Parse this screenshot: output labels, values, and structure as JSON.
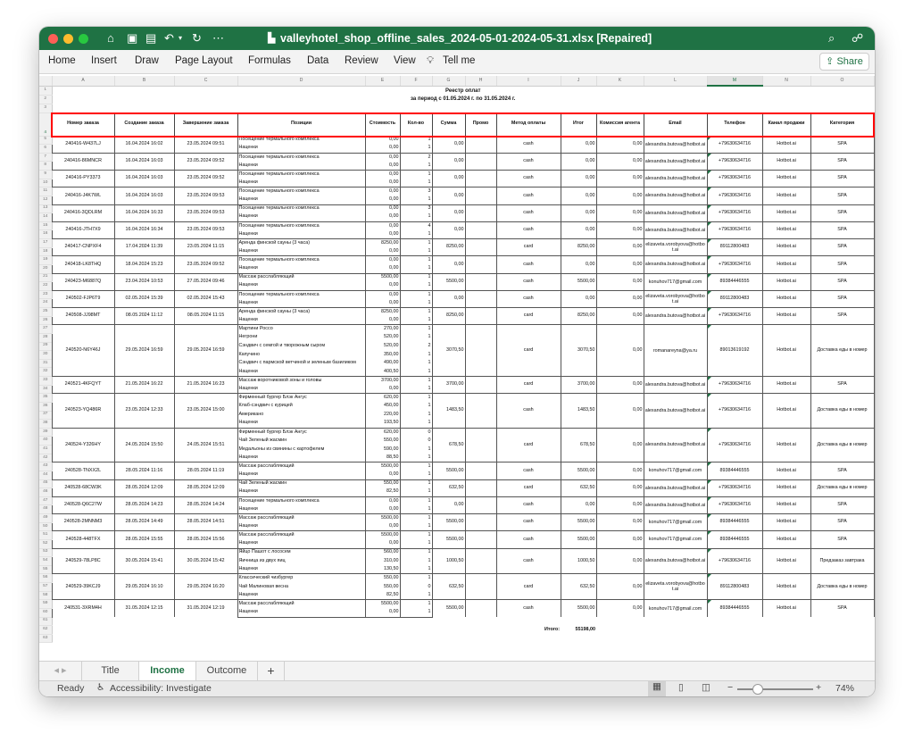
{
  "window": {
    "title": "valleyhotel_shop_offline_sales_2024-05-01-2024-05-31.xlsx [Repaired]"
  },
  "ribbon": {
    "tabs": [
      "Home",
      "Insert",
      "Draw",
      "Page Layout",
      "Formulas",
      "Data",
      "Review",
      "View"
    ],
    "tell_me": "Tell me",
    "share": "Share"
  },
  "columns": [
    "A",
    "B",
    "C",
    "D",
    "E",
    "F",
    "G",
    "H",
    "I",
    "J",
    "K",
    "L",
    "M",
    "N",
    "O"
  ],
  "report": {
    "title": "Реестр оплат",
    "period": "за период с 01.05.2024 г. по 31.05.2024 г."
  },
  "headers": [
    "Номер заказа",
    "Создание заказа",
    "Завершение заказа",
    "Позиции",
    "Стоимость",
    "Кол-во",
    "Сумма",
    "Промо",
    "Метод оплаты",
    "Итог",
    "Комиссия агента",
    "Email",
    "Телефон",
    "Канал продажи",
    "Категория"
  ],
  "orders": [
    {
      "id": "240416-W437LJ",
      "created": "16.04.2024 16:02",
      "completed": "23.05.2024 09:51",
      "items": [
        [
          "Посещение термального комплекса",
          "0,00",
          "1"
        ],
        [
          "Наценки",
          "0,00",
          "1"
        ]
      ],
      "sum": "0,00",
      "promo": "",
      "method": "cash",
      "total": "0,00",
      "commission": "0,00",
      "email": "alexandra.butova@hotbot.ai",
      "phone": "+79630634716",
      "channel": "Hotbot.ai",
      "category": "SPA"
    },
    {
      "id": "240416-86MNCR",
      "created": "16.04.2024 16:03",
      "completed": "23.05.2024 09:52",
      "items": [
        [
          "Посещение термального комплекса",
          "0,00",
          "2"
        ],
        [
          "Наценки",
          "0,00",
          "1"
        ]
      ],
      "sum": "0,00",
      "promo": "",
      "method": "cash",
      "total": "0,00",
      "commission": "0,00",
      "email": "alexandra.butova@hotbot.ai",
      "phone": "+79630634716",
      "channel": "Hotbot.ai",
      "category": "SPA"
    },
    {
      "id": "240416-PY3373",
      "created": "16.04.2024 16:03",
      "completed": "23.05.2024 09:52",
      "items": [
        [
          "Посещение термального комплекса",
          "0,00",
          "1"
        ],
        [
          "Наценки",
          "0,00",
          "1"
        ]
      ],
      "sum": "0,00",
      "promo": "",
      "method": "cash",
      "total": "0,00",
      "commission": "0,00",
      "email": "alexandra.butova@hotbot.ai",
      "phone": "+79630634716",
      "channel": "Hotbot.ai",
      "category": "SPA"
    },
    {
      "id": "240416-J4K7WL",
      "created": "16.04.2024 16:03",
      "completed": "23.05.2024 09:53",
      "items": [
        [
          "Посещение термального комплекса",
          "0,00",
          "3"
        ],
        [
          "Наценки",
          "0,00",
          "1"
        ]
      ],
      "sum": "0,00",
      "promo": "",
      "method": "cash",
      "total": "0,00",
      "commission": "0,00",
      "email": "alexandra.butova@hotbot.ai",
      "phone": "+79630634716",
      "channel": "Hotbot.ai",
      "category": "SPA"
    },
    {
      "id": "240416-3QDLRM",
      "created": "16.04.2024 16:33",
      "completed": "23.05.2024 09:53",
      "items": [
        [
          "Посещение термального комплекса",
          "0,00",
          "3"
        ],
        [
          "Наценки",
          "0,00",
          "1"
        ]
      ],
      "sum": "0,00",
      "promo": "",
      "method": "cash",
      "total": "0,00",
      "commission": "0,00",
      "email": "alexandra.butova@hotbot.ai",
      "phone": "+79630634716",
      "channel": "Hotbot.ai",
      "category": "SPA"
    },
    {
      "id": "240416-JTH7X9",
      "created": "16.04.2024 16:34",
      "completed": "23.05.2024 09:53",
      "items": [
        [
          "Посещение термального комплекса",
          "0,00",
          "4"
        ],
        [
          "Наценки",
          "0,00",
          "1"
        ]
      ],
      "sum": "0,00",
      "promo": "",
      "method": "cash",
      "total": "0,00",
      "commission": "0,00",
      "email": "alexandra.butova@hotbot.ai",
      "phone": "+79630634716",
      "channel": "Hotbot.ai",
      "category": "SPA"
    },
    {
      "id": "240417-CNPXF4",
      "created": "17.04.2024 11:39",
      "completed": "23.05.2024 11:15",
      "items": [
        [
          "Аренда финской сауны (3 часа)",
          "8250,00",
          "1"
        ],
        [
          "Наценки",
          "0,00",
          "1"
        ]
      ],
      "sum": "8250,00",
      "promo": "",
      "method": "card",
      "total": "8250,00",
      "commission": "0,00",
      "email": "elizaveta.vorobyova@hotbot.ai",
      "phone": "89112800483",
      "channel": "Hotbot.ai",
      "category": "SPA"
    },
    {
      "id": "240418-LK8THQ",
      "created": "18.04.2024 15:23",
      "completed": "23.05.2024 09:52",
      "items": [
        [
          "Посещение термального комплекса",
          "0,00",
          "1"
        ],
        [
          "Наценки",
          "0,00",
          "1"
        ]
      ],
      "sum": "0,00",
      "promo": "",
      "method": "cash",
      "total": "0,00",
      "commission": "0,00",
      "email": "alexandra.butova@hotbot.ai",
      "phone": "+79630634716",
      "channel": "Hotbot.ai",
      "category": "SPA"
    },
    {
      "id": "240423-M6887Q",
      "created": "23.04.2024 10:53",
      "completed": "27.05.2024 09:46",
      "items": [
        [
          "Массаж расслабляющий",
          "5500,00",
          "1"
        ],
        [
          "Наценки",
          "0,00",
          "1"
        ]
      ],
      "sum": "5500,00",
      "promo": "",
      "method": "cash",
      "total": "5500,00",
      "commission": "0,00",
      "email": "konuhov717@gmail.com",
      "phone": "89384446555",
      "channel": "Hotbot.ai",
      "category": "SPA"
    },
    {
      "id": "240502-FJP6T9",
      "created": "02.05.2024 15:39",
      "completed": "02.05.2024 15:43",
      "items": [
        [
          "Посещение термального комплекса",
          "0,00",
          "1"
        ],
        [
          "Наценки",
          "0,00",
          "1"
        ]
      ],
      "sum": "0,00",
      "promo": "",
      "method": "cash",
      "total": "0,00",
      "commission": "0,00",
      "email": "elizaveta.vorobyova@hotbot.ai",
      "phone": "89112800483",
      "channel": "Hotbot.ai",
      "category": "SPA"
    },
    {
      "id": "240508-JJ98MT",
      "created": "08.05.2024 11:12",
      "completed": "08.05.2024 11:15",
      "items": [
        [
          "Аренда финской сауны (3 часа)",
          "8250,00",
          "1"
        ],
        [
          "Наценки",
          "0,00",
          "1"
        ]
      ],
      "sum": "8250,00",
      "promo": "",
      "method": "card",
      "total": "8250,00",
      "commission": "0,00",
      "email": "alexandra.butova@hotbot.ai",
      "phone": "+79630634716",
      "channel": "Hotbot.ai",
      "category": "SPA"
    },
    {
      "id": "240520-N6Y46J",
      "created": "29.05.2024 16:59",
      "completed": "29.05.2024 16:59",
      "items": [
        [
          "Мартини Россо",
          "270,00",
          "1"
        ],
        [
          "Негрони",
          "520,00",
          "1"
        ],
        [
          "Сэндвич с семгой и творожным сыром",
          "520,00",
          "2"
        ],
        [
          "Капучино",
          "350,00",
          "1"
        ],
        [
          "Сэндвич с пармской ветчиной и зеленым базиликом",
          "490,00",
          "1"
        ],
        [
          "Наценки",
          "400,50",
          "1"
        ]
      ],
      "sum": "3070,50",
      "promo": "",
      "method": "card",
      "total": "3070,50",
      "commission": "0,00",
      "email": "romanareyna@ya.ru",
      "phone": "89013619192",
      "channel": "Hotbot.ai",
      "category": "Доставка еды в номер"
    },
    {
      "id": "240521-4KFQYT",
      "created": "21.05.2024 16:22",
      "completed": "21.05.2024 16:23",
      "items": [
        [
          "Массаж воротниковой зоны и головы",
          "3700,00",
          "1"
        ],
        [
          "Наценки",
          "0,00",
          "1"
        ]
      ],
      "sum": "3700,00",
      "promo": "",
      "method": "card",
      "total": "3700,00",
      "commission": "0,00",
      "email": "alexandra.butova@hotbot.ai",
      "phone": "+79630634716",
      "channel": "Hotbot.ai",
      "category": "SPA"
    },
    {
      "id": "240523-YQ486R",
      "created": "23.05.2024 12:33",
      "completed": "23.05.2024 15:00",
      "items": [
        [
          "Фирменный бургер Блэк Ангус",
          "620,00",
          "1"
        ],
        [
          "Клаб-сэндвич с курицей",
          "450,00",
          "1"
        ],
        [
          "Американо",
          "220,00",
          "1"
        ],
        [
          "Наценки",
          "193,50",
          "1"
        ]
      ],
      "sum": "1483,50",
      "promo": "",
      "method": "cash",
      "total": "1483,50",
      "commission": "0,00",
      "email": "alexandra.butova@hotbot.ai",
      "phone": "+79630634716",
      "channel": "Hotbot.ai",
      "category": "Доставка еды в номер"
    },
    {
      "id": "240524-Y326HY",
      "created": "24.05.2024 15:50",
      "completed": "24.05.2024 15:51",
      "items": [
        [
          "Фирменный бургер Блэк Ангус",
          "620,00",
          "0"
        ],
        [
          "Чай Зеленый жасмин",
          "550,00",
          "0"
        ],
        [
          "Медальоны из свинины с картофелем",
          "590,00",
          "1"
        ],
        [
          "Наценки",
          "88,50",
          "1"
        ]
      ],
      "sum": "678,50",
      "promo": "",
      "method": "card",
      "total": "678,50",
      "commission": "0,00",
      "email": "alexandra.butova@hotbot.ai",
      "phone": "+79630634716",
      "channel": "Hotbot.ai",
      "category": "Доставка еды в номер"
    },
    {
      "id": "240528-TNXX2L",
      "created": "28.05.2024 11:16",
      "completed": "28.05.2024 11:19",
      "items": [
        [
          "Массаж расслабляющий",
          "5500,00",
          "1"
        ],
        [
          "Наценки",
          "0,00",
          "1"
        ]
      ],
      "sum": "5500,00",
      "promo": "",
      "method": "cash",
      "total": "5500,00",
      "commission": "0,00",
      "email": "konuhov717@gmail.com",
      "phone": "89384446555",
      "channel": "Hotbot.ai",
      "category": "SPA"
    },
    {
      "id": "240528-68CW3K",
      "created": "28.05.2024 12:09",
      "completed": "28.05.2024 12:09",
      "items": [
        [
          "Чай Зеленый жасмин",
          "550,00",
          "1"
        ],
        [
          "Наценки",
          "82,50",
          "1"
        ]
      ],
      "sum": "632,50",
      "promo": "",
      "method": "card",
      "total": "632,50",
      "commission": "0,00",
      "email": "alexandra.butova@hotbot.ai",
      "phone": "+79630634716",
      "channel": "Hotbot.ai",
      "category": "Доставка еды в номер"
    },
    {
      "id": "240528-Q6C27W",
      "created": "28.05.2024 14:23",
      "completed": "28.05.2024 14:24",
      "items": [
        [
          "Посещение термального комплекса",
          "0,00",
          "1"
        ],
        [
          "Наценки",
          "0,00",
          "1"
        ]
      ],
      "sum": "0,00",
      "promo": "",
      "method": "cash",
      "total": "0,00",
      "commission": "0,00",
      "email": "alexandra.butova@hotbot.ai",
      "phone": "+79630634716",
      "channel": "Hotbot.ai",
      "category": "SPA"
    },
    {
      "id": "240528-2MNNM3",
      "created": "28.05.2024 14:49",
      "completed": "28.05.2024 14:51",
      "items": [
        [
          "Массаж расслабляющий",
          "5500,00",
          "1"
        ],
        [
          "Наценки",
          "0,00",
          "1"
        ]
      ],
      "sum": "5500,00",
      "promo": "",
      "method": "cash",
      "total": "5500,00",
      "commission": "0,00",
      "email": "konuhov717@gmail.com",
      "phone": "89384446555",
      "channel": "Hotbot.ai",
      "category": "SPA"
    },
    {
      "id": "240528-448TFX",
      "created": "28.05.2024 15:55",
      "completed": "28.05.2024 15:56",
      "items": [
        [
          "Массаж расслабляющий",
          "5500,00",
          "1"
        ],
        [
          "Наценки",
          "0,00",
          "1"
        ]
      ],
      "sum": "5500,00",
      "promo": "",
      "method": "cash",
      "total": "5500,00",
      "commission": "0,00",
      "email": "konuhov717@gmail.com",
      "phone": "89384446555",
      "channel": "Hotbot.ai",
      "category": "SPA"
    },
    {
      "id": "240529-78LP8C",
      "created": "30.05.2024 15:41",
      "completed": "30.05.2024 15:42",
      "items": [
        [
          "Яйцо Пашот с лососем",
          "560,00",
          "1"
        ],
        [
          "Яичница из двух яиц",
          "310,00",
          "1"
        ],
        [
          "Наценки",
          "130,50",
          "1"
        ]
      ],
      "sum": "1000,50",
      "promo": "",
      "method": "cash",
      "total": "1000,50",
      "commission": "0,00",
      "email": "alexandra.butova@hotbot.ai",
      "phone": "+79630634716",
      "channel": "Hotbot.ai",
      "category": "Предзаказ завтрака"
    },
    {
      "id": "240529-39KCJ9",
      "created": "29.05.2024 16:10",
      "completed": "29.05.2024 16:20",
      "items": [
        [
          "Классический чизбургер",
          "550,00",
          "1"
        ],
        [
          "Чай Малиновая весна",
          "550,00",
          "0"
        ],
        [
          "Наценки",
          "82,50",
          "1"
        ]
      ],
      "sum": "632,50",
      "promo": "",
      "method": "card",
      "total": "632,50",
      "commission": "0,00",
      "email": "elizaveta.vorobyova@hotbot.ai",
      "phone": "89112800483",
      "channel": "Hotbot.ai",
      "category": "Доставка еды в номер"
    },
    {
      "id": "240531-3XRM4H",
      "created": "31.05.2024 12:15",
      "completed": "31.05.2024 12:19",
      "items": [
        [
          "Массаж расслабляющий",
          "5500,00",
          "1"
        ],
        [
          "Наценки",
          "0,00",
          "1"
        ]
      ],
      "sum": "5500,00",
      "promo": "",
      "method": "cash",
      "total": "5500,00",
      "commission": "0,00",
      "email": "konuhov717@gmail.com",
      "phone": "89384446555",
      "channel": "Hotbot.ai",
      "category": "SPA"
    }
  ],
  "footer": {
    "total_label": "Итого:",
    "total_value": "55198,00"
  },
  "sheet_tabs": [
    "Title",
    "Income",
    "Outcome"
  ],
  "active_tab": "Income",
  "status": {
    "ready": "Ready",
    "accessibility": "Accessibility: Investigate",
    "zoom": "74%",
    "zoom_level": 0.74
  },
  "colors": {
    "accent": "#1f7244",
    "highlight": "#ff0000"
  }
}
